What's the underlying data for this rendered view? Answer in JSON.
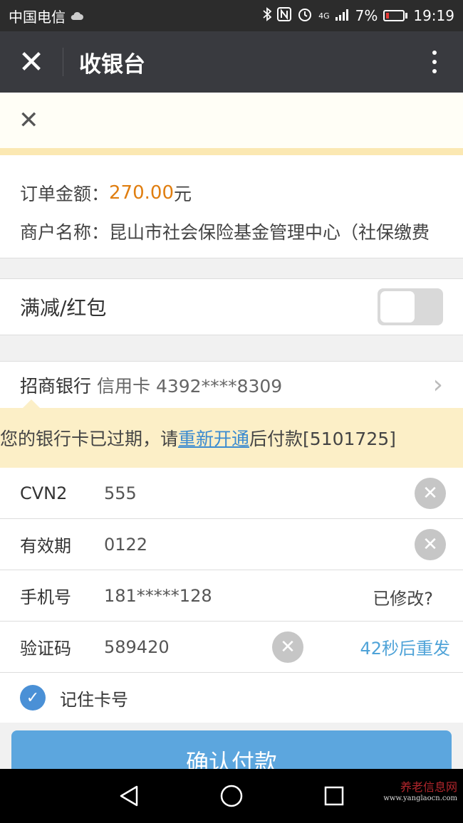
{
  "status_bar": {
    "carrier": "中国电信",
    "network": "4G",
    "battery_percent": "7%",
    "time": "19:19",
    "icons": [
      "cloud-icon",
      "bluetooth-icon",
      "nfc-icon",
      "alarm-icon",
      "signal-icon",
      "battery-icon"
    ]
  },
  "titlebar": {
    "close_glyph": "✕",
    "title": "收银台",
    "more_icon": "more-vertical-icon"
  },
  "closebar": {
    "close_glyph": "✕"
  },
  "order": {
    "amount_label": "订单金额：",
    "amount_value": "270.00",
    "amount_unit": " 元",
    "merchant_label": "商户名称：",
    "merchant_value": "昆山市社会保险基金管理中心（社保缴费"
  },
  "discount": {
    "label": "满减/红包",
    "enabled": false
  },
  "card": {
    "bank": "招商银行",
    "card_info": "信用卡 4392****8309",
    "chevron": "›"
  },
  "warning": {
    "prefix": "您的银行卡已过期，请",
    "link": "重新开通",
    "suffix": "后付款[5101725]"
  },
  "form": {
    "cvn2_label": "CVN2",
    "cvn2_value": "555",
    "expiry_label": "有效期",
    "expiry_value": "0122",
    "phone_label": "手机号",
    "phone_value": "181*****128",
    "phone_modified": "已修改?",
    "code_label": "验证码",
    "code_value": "589420",
    "resend": "42秒后重发",
    "clear_glyph": "✕"
  },
  "remember": {
    "label": "记住卡号",
    "checked": true,
    "check_glyph": "✓"
  },
  "confirm_button": "确认付款",
  "watermark": {
    "text": "养老信息网",
    "url": "www.yanglaocn.com"
  },
  "colors": {
    "accent": "#5ca6de",
    "amount": "#e07e10",
    "link": "#3b8bd0",
    "warning_bg": "#fcefc7"
  }
}
